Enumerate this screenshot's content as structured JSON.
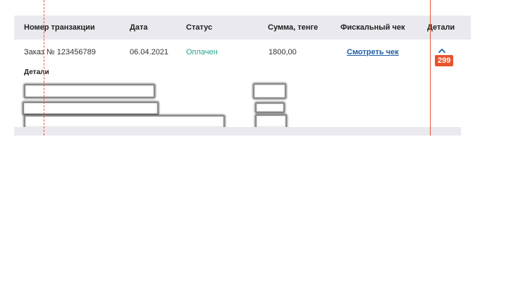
{
  "table": {
    "headers": {
      "transaction": "Номер транзакции",
      "date": "Дата",
      "status": "Статус",
      "amount": "Сумма, тенге",
      "fiscal": "Фискальный чек",
      "details": "Детали"
    },
    "row": {
      "transaction": "Заказ № 123456789",
      "date": "06.04.2021",
      "status": "Оплачен",
      "amount": "1800,00",
      "fiscal_link": "Смотреть чек"
    },
    "details_title": "Детали"
  },
  "overlay": {
    "measurement_badge": "299",
    "guide_color": "#e4572e"
  },
  "colors": {
    "header_bg": "#e9e9ef",
    "status_paid": "#24a58a",
    "link": "#1d5fa8"
  },
  "icons": {
    "toggle": "chevron-up-icon"
  }
}
